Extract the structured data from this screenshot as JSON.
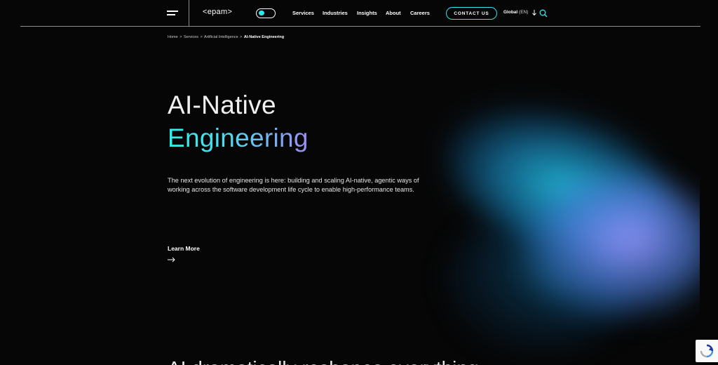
{
  "header": {
    "logo_text": "<epam>",
    "nav": [
      "Services",
      "Industries",
      "Insights",
      "About",
      "Careers"
    ],
    "contact_label": "CONTACT US",
    "global_label": "Global",
    "global_lang": "(EN)"
  },
  "breadcrumb": {
    "items": [
      "Home",
      "Services",
      "Artificial Intelligence"
    ],
    "current": "AI-Native Engineering",
    "separator": ">"
  },
  "hero": {
    "title_line1": "AI-Native",
    "title_line2": "Engineering",
    "description": "The next evolution of engineering is here: building and scaling AI-native, agentic ways of working across the software development life cycle to enable high-performance teams.",
    "cta_label": "Learn More"
  },
  "next_section": {
    "heading_partial": "AI dramatically reshapes everything"
  },
  "colors": {
    "accent_cyan": "#2ee6ee",
    "accent_violet": "#9b8cf2",
    "background": "#060606"
  },
  "icons": {
    "menu": "hamburger-menu-icon",
    "toggle": "theme-toggle-icon",
    "global_arrow": "arrow-down-icon",
    "search": "search-icon",
    "cta_arrow": "arrow-right-icon",
    "recaptcha": "recaptcha-icon"
  }
}
